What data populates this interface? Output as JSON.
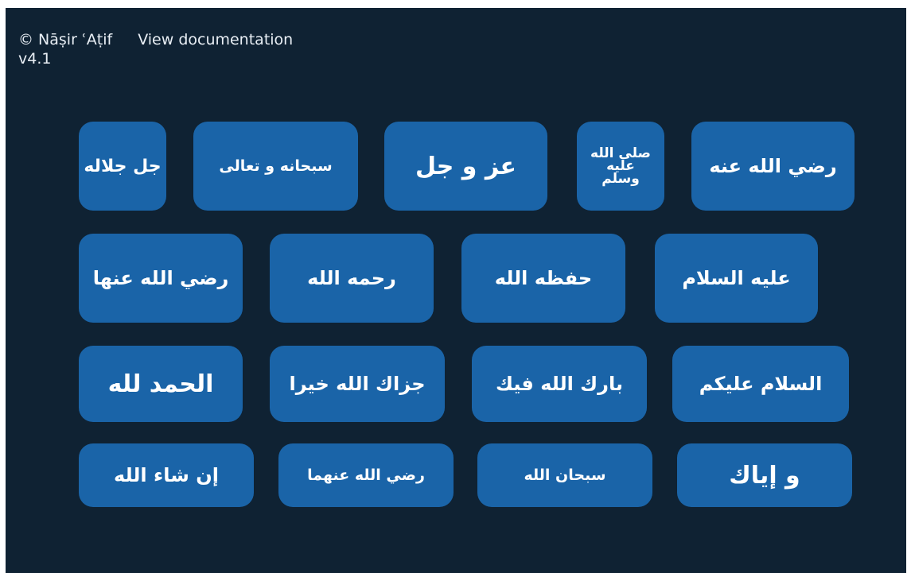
{
  "header": {
    "copyright": "© Nāṣir ʿAṭif",
    "doc_link": "View documentation",
    "version": "v4.1"
  },
  "colors": {
    "page_background": "#0f2233",
    "button_background": "#1a64a8",
    "button_text": "#ffffff",
    "header_text": "#e8eef4"
  },
  "buttons": {
    "jalla_jalaluhu": "جل جلاله",
    "subhanahu_wa_taala": "سبحانه و تعالى",
    "azza_wa_jal": "عز و جل",
    "salla_allahu": {
      "line1": "صلى الله",
      "line2": "عليه",
      "line3": "وسلم"
    },
    "radi_allahu_anhu": "رضي الله عنه",
    "radi_allahu_anha": "رضي الله عنها",
    "rahimahullah": "رحمه الله",
    "hafidhahullah": "حفظه الله",
    "alayhi_assalam": "عليه السلام",
    "alhamdulillah": "الحمد لله",
    "jazakallah_khayran": "جزاك الله خيرا",
    "barakallahu_feek": "بارك الله فيك",
    "assalamu_alaykum": "السلام عليكم",
    "in_sha_allah": "إن شاء الله",
    "radi_allahu_anhuma": "رضي الله عنهما",
    "subhanallah": "سبحان الله",
    "wa_iyyak": "و إياك"
  }
}
